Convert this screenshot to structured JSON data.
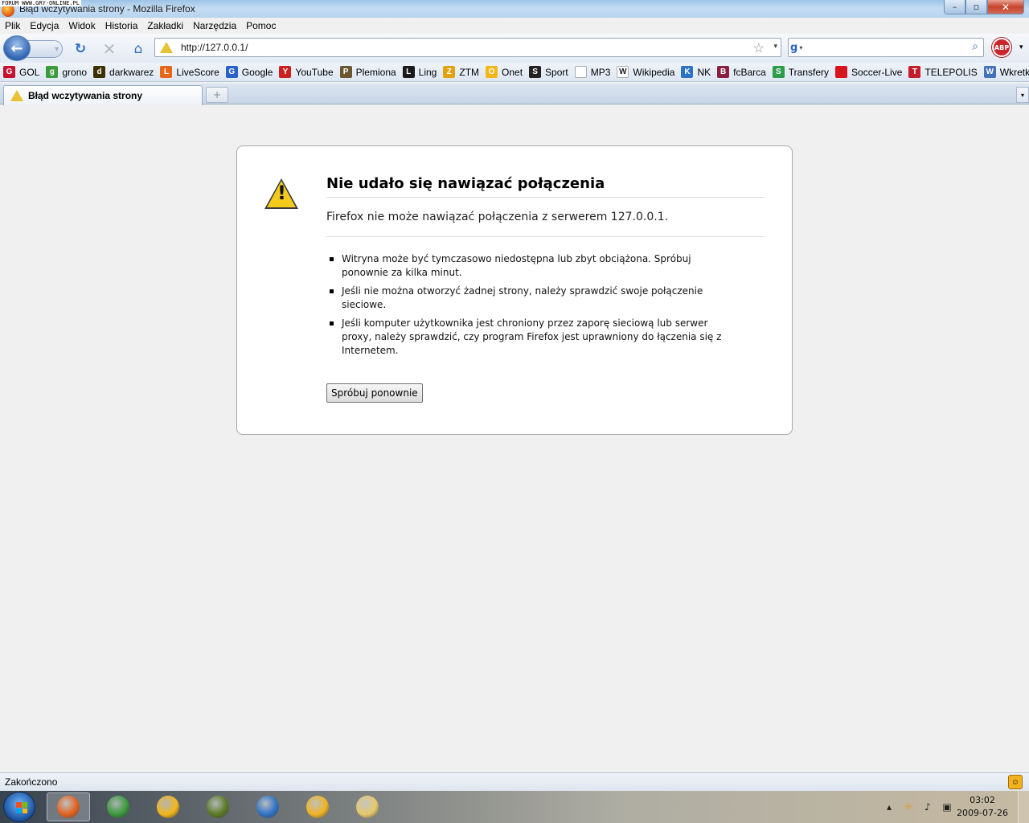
{
  "watermark": "FORUM WWW.GRY-ONLINE.PL",
  "window": {
    "title": "Błąd wczytywania strony - Mozilla Firefox",
    "minimize": "–",
    "maximize": "▫",
    "close": "✕"
  },
  "menu": [
    "Plik",
    "Edycja",
    "Widok",
    "Historia",
    "Zakładki",
    "Narzędzia",
    "Pomoc"
  ],
  "nav": {
    "url": "http://127.0.0.1/",
    "search_placeholder": ""
  },
  "abp_label": "ABP",
  "bookmarks": [
    {
      "label": "GOL",
      "icon": "gol-icon",
      "color": "#c8102e",
      "glyph": "G"
    },
    {
      "label": "grono",
      "icon": "grono-icon",
      "color": "#3a9b3a",
      "glyph": "g"
    },
    {
      "label": "darkwarez",
      "icon": "darkwarez-icon",
      "color": "#3d3000",
      "glyph": "d"
    },
    {
      "label": "LiveScore",
      "icon": "livescore-icon",
      "color": "#e8681a",
      "glyph": "L"
    },
    {
      "label": "Google",
      "icon": "google-icon",
      "color": "#2a62c9",
      "glyph": "G"
    },
    {
      "label": "YouTube",
      "icon": "youtube-icon",
      "color": "#cc1f1f",
      "glyph": "Y"
    },
    {
      "label": "Plemiona",
      "icon": "plemiona-icon",
      "color": "#6b5632",
      "glyph": "P"
    },
    {
      "label": "Ling",
      "icon": "ling-icon",
      "color": "#1a1a1a",
      "glyph": "L"
    },
    {
      "label": "ZTM",
      "icon": "ztm-icon",
      "color": "#e2a312",
      "glyph": "Z"
    },
    {
      "label": "Onet",
      "icon": "onet-icon",
      "color": "#f4b716",
      "glyph": "O"
    },
    {
      "label": "Sport",
      "icon": "sport-icon",
      "color": "#222222",
      "glyph": "S"
    },
    {
      "label": "MP3",
      "icon": "page-icon",
      "color": "#ffffff",
      "glyph": ""
    },
    {
      "label": "Wikipedia",
      "icon": "wikipedia-icon",
      "color": "#ffffff",
      "glyph": "W"
    },
    {
      "label": "NK",
      "icon": "nk-icon",
      "color": "#2e72c6",
      "glyph": "K"
    },
    {
      "label": "fcBarca",
      "icon": "fcbarca-icon",
      "color": "#8b1f3f",
      "glyph": "B"
    },
    {
      "label": "Transfery",
      "icon": "transfery-icon",
      "color": "#2d9b4a",
      "glyph": "S"
    },
    {
      "label": "Soccer-Live",
      "icon": "soccer-live-icon",
      "color": "#d8141e",
      "glyph": ""
    },
    {
      "label": "TELEPOLIS",
      "icon": "telepolis-icon",
      "color": "#c41e2a",
      "glyph": "T"
    },
    {
      "label": "Wkretka",
      "icon": "wkretka-icon",
      "color": "#4472b8",
      "glyph": "W"
    }
  ],
  "tab": {
    "title": "Błąd wczytywania strony",
    "new_tab": "+",
    "list": "▾"
  },
  "error": {
    "title": "Nie udało się nawiązać połączenia",
    "subtitle": "Firefox nie może nawiązać połączenia z serwerem 127.0.0.1.",
    "items": [
      "Witryna może być tymczasowo niedostępna lub zbyt obciążona. Spróbuj ponownie za kilka minut.",
      "Jeśli nie można otworzyć żadnej strony, należy sprawdzić swoje połączenie sieciowe.",
      "Jeśli komputer użytkownika jest chroniony przez zaporę sieciową lub serwer proxy, należy sprawdzić, czy program Firefox jest uprawniony do łączenia się z Internetem."
    ],
    "retry_label": "Spróbuj ponownie"
  },
  "status": {
    "text": "Zakończono"
  },
  "taskbar": {
    "apps": [
      {
        "name": "firefox-taskbar-button",
        "icon": "firefox-icon",
        "active": true,
        "color": "#e4611a"
      },
      {
        "name": "chrome-taskbar-button",
        "icon": "chrome-icon",
        "active": false,
        "color": "#3a9b3a"
      },
      {
        "name": "gadu-gadu-taskbar-button",
        "icon": "sun-icon",
        "active": false,
        "color": "#f4b716"
      },
      {
        "name": "quake-taskbar-button",
        "icon": "game-icon",
        "active": false,
        "color": "#5a7a22"
      },
      {
        "name": "aimp-taskbar-button",
        "icon": "aimp-icon",
        "active": false,
        "color": "#2e72c6"
      },
      {
        "name": "winamp-taskbar-button",
        "icon": "winamp-icon",
        "active": false,
        "color": "#f2b41e"
      },
      {
        "name": "explorer-taskbar-button",
        "icon": "folder-icon",
        "active": false,
        "color": "#e7c96a"
      }
    ],
    "clock_time": "03:02",
    "clock_date": "2009-07-26"
  }
}
